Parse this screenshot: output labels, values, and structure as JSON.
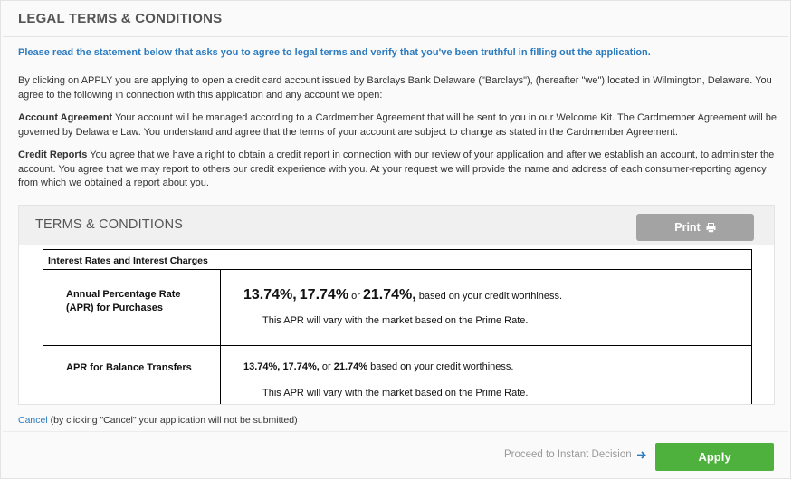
{
  "page": {
    "title": "LEGAL TERMS & CONDITIONS",
    "intro": "Please read the statement below that asks you to agree to legal terms and verify that you've been truthful in filling out the application.",
    "paragraph1": "By clicking on APPLY you are applying to open a credit card account issued by Barclays Bank Delaware (\"Barclays\"), (hereafter \"we\") located in Wilmington, Delaware. You agree to the following in connection with this application and any account we open:",
    "account_agreement": {
      "heading": "Account Agreement",
      "text": " Your account will be managed according to a Cardmember Agreement that will be sent to you in our Welcome Kit. The Cardmember Agreement will be governed by Delaware Law. You understand and agree that the terms of your account are subject to change as stated in the Cardmember Agreement."
    },
    "credit_reports": {
      "heading": "Credit Reports",
      "text": " You agree that we have a right to obtain a credit report in connection with our review of your application and after we establish an account, to administer the account. You agree that we may report to others our credit experience with you. At your request we will provide the name and address of each consumer-reporting agency from which we obtained a report about you."
    }
  },
  "terms_panel": {
    "title": "TERMS & CONDITIONS",
    "print_label": "Print",
    "print_icon": "printer-icon",
    "table": {
      "header": "Interest Rates and Interest Charges",
      "rows": [
        {
          "label": "Annual Percentage Rate (APR) for Purchases",
          "rate1": "13.74%,",
          "rate2": "17.74%",
          "or_text": " or ",
          "rate3": "21.74%,",
          "suffix": " based on your credit worthiness.",
          "note": "This APR will vary with the market based on the Prime Rate."
        },
        {
          "label": "APR for Balance Transfers",
          "rate1": "13.74%,",
          "rate2": "17.74%,",
          "or_text": " or ",
          "rate3": "21.74%",
          "suffix": " based on your credit worthiness.",
          "note": "This APR will vary with the market based on the Prime Rate."
        }
      ]
    }
  },
  "footer": {
    "cancel_label": "Cancel",
    "cancel_note": " (by clicking \"Cancel\" your application will not be submitted)",
    "proceed_text": "Proceed to Instant Decision",
    "apply_label": "Apply",
    "accent_green": "#4eb13d",
    "link_blue": "#2c7bbf"
  }
}
